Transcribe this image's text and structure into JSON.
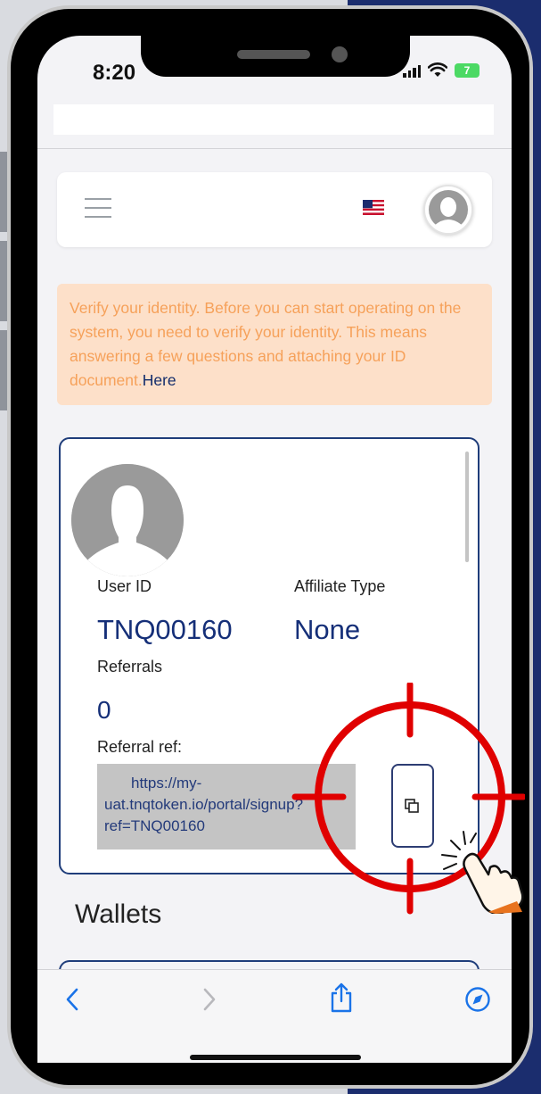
{
  "status_bar": {
    "time": "8:20",
    "battery": "7"
  },
  "alert": {
    "text": "Verify your identity. Before you can start operating on the system, you need to verify your identity. This means answering a few questions and attaching your ID document.",
    "link": "Here"
  },
  "profile": {
    "user_id_label": "User ID",
    "user_id_value": "TNQ00160",
    "affiliate_type_label": "Affiliate Type",
    "affiliate_type_value": "None",
    "referrals_label": "Referrals",
    "referrals_value": "0",
    "referral_ref_label": "Referral ref:",
    "referral_ref_line1": "https://my-",
    "referral_ref_line2": "uat.tnqtoken.io/portal/signup?",
    "referral_ref_line3": "ref=TNQ00160"
  },
  "wallets": {
    "title": "Wallets"
  },
  "colors": {
    "brand_navy": "#152f78",
    "alert_bg": "#fde0c9",
    "alert_text": "#f6a15a",
    "highlight_red": "#e00000",
    "toolbar_blue": "#1a73e8"
  },
  "icons": [
    "menu-icon",
    "us-flag-icon",
    "user-avatar-icon",
    "copy-icon",
    "back-icon",
    "forward-icon",
    "share-icon",
    "compass-icon",
    "crosshair-target-icon",
    "tap-hand-icon"
  ]
}
